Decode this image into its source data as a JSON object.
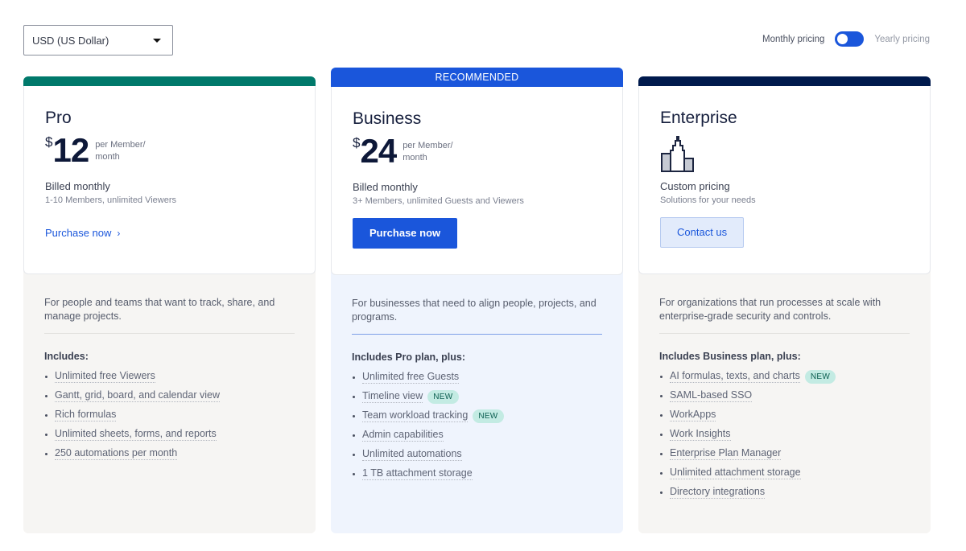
{
  "currency": {
    "selected": "USD (US Dollar)"
  },
  "billing_toggle": {
    "left_label": "Monthly pricing",
    "right_label": "Yearly pricing",
    "state": "monthly"
  },
  "colors": {
    "pro_accent": "#00796b",
    "business_accent": "#1a56db",
    "enterprise_accent": "#001a4d",
    "new_badge_bg": "#c3ebe3"
  },
  "plans": {
    "pro": {
      "name": "Pro",
      "currency_symbol": "$",
      "price": "12",
      "per_line1": "per Member/",
      "per_line2": "month",
      "billed": "Billed monthly",
      "billed_sub": "1-10 Members, unlimited Viewers",
      "cta": "Purchase now",
      "description": "For people and teams that want to track, share, and manage projects.",
      "includes_title": "Includes:",
      "features": [
        {
          "text": "Unlimited free Viewers"
        },
        {
          "text": "Gantt, grid, board, and calendar view"
        },
        {
          "text": "Rich formulas"
        },
        {
          "text": "Unlimited sheets, forms, and reports"
        },
        {
          "text": "250 automations per month"
        }
      ]
    },
    "business": {
      "ribbon": "RECOMMENDED",
      "name": "Business",
      "currency_symbol": "$",
      "price": "24",
      "per_line1": "per Member/",
      "per_line2": "month",
      "billed": "Billed monthly",
      "billed_sub": "3+ Members, unlimited Guests and Viewers",
      "cta": "Purchase now",
      "description": "For businesses that need to align people, projects, and programs.",
      "includes_title": "Includes Pro plan, plus:",
      "features": [
        {
          "text": "Unlimited free Guests"
        },
        {
          "text": "Timeline view",
          "badge": "NEW"
        },
        {
          "text": "Team workload tracking",
          "badge": "NEW"
        },
        {
          "text": "Admin capabilities"
        },
        {
          "text": "Unlimited automations"
        },
        {
          "text": "1 TB attachment storage"
        }
      ]
    },
    "enterprise": {
      "name": "Enterprise",
      "icon": "building-icon",
      "billed": "Custom pricing",
      "billed_sub": "Solutions for your needs",
      "cta": "Contact us",
      "description": "For organizations that run processes at scale with enterprise-grade security and controls.",
      "includes_title": "Includes Business plan, plus:",
      "features": [
        {
          "text": "AI formulas, texts, and charts",
          "badge": "NEW"
        },
        {
          "text": "SAML-based SSO"
        },
        {
          "text": "WorkApps"
        },
        {
          "text": "Work Insights"
        },
        {
          "text": "Enterprise Plan Manager"
        },
        {
          "text": "Unlimited attachment storage"
        },
        {
          "text": "Directory integrations"
        }
      ]
    }
  }
}
